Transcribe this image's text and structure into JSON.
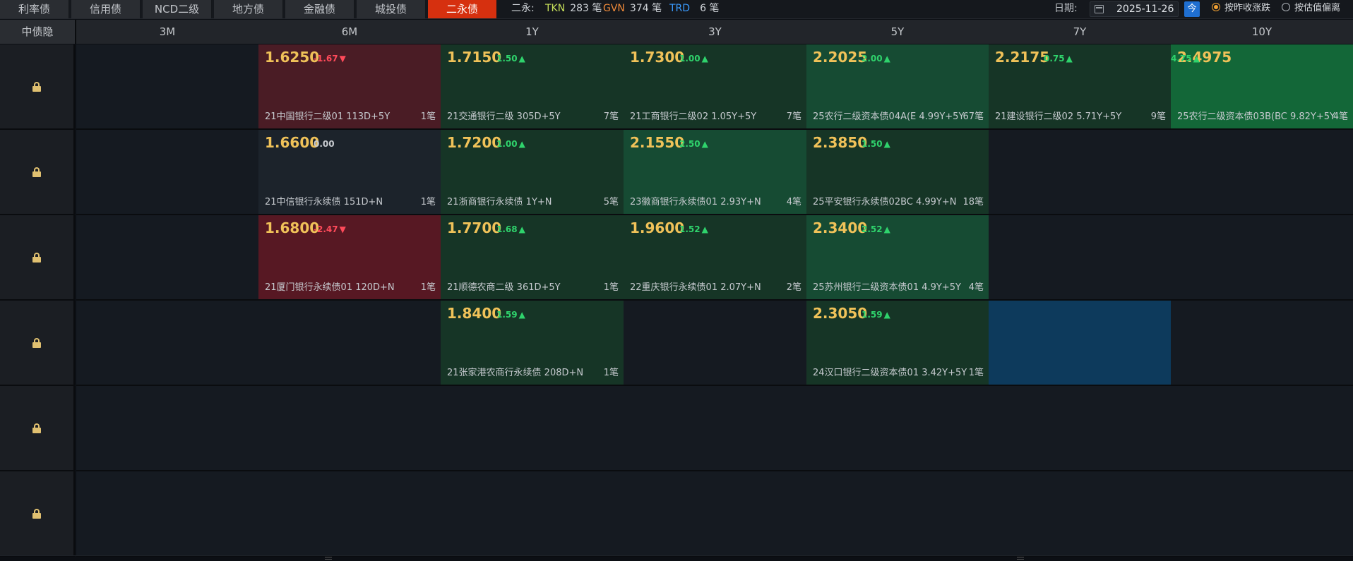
{
  "tabs": [
    {
      "label": "利率债",
      "active": false
    },
    {
      "label": "信用债",
      "active": false
    },
    {
      "label": "NCD二级",
      "active": false
    },
    {
      "label": "地方债",
      "active": false
    },
    {
      "label": "金融债",
      "active": false
    },
    {
      "label": "城投债",
      "active": false
    },
    {
      "label": "二永债",
      "active": true
    }
  ],
  "stats": {
    "prefix": "二永:",
    "tkn": {
      "key": "TKN",
      "value": "283 笔",
      "color": "#c7e05a"
    },
    "gvn": {
      "key": "GVN",
      "value": "374 笔",
      "color": "#f08a3a"
    },
    "trd": {
      "key": "TRD",
      "value": "6 笔",
      "color": "#3a9bff"
    }
  },
  "date": {
    "label": "日期:",
    "value": "2025-11-26",
    "today_button": "今"
  },
  "radios": [
    {
      "label": "按昨收涨跌",
      "checked": true
    },
    {
      "label": "按估值偏离",
      "checked": false
    }
  ],
  "columns": [
    "中债隐",
    "3M",
    "6M",
    "1Y",
    "3Y",
    "5Y",
    "7Y",
    "10Y"
  ],
  "rows": [
    {
      "cells": [
        null,
        {
          "yield": "1.6250",
          "change": "-1.67",
          "dir": "down",
          "bond": "21中国银行二级01 113D+5Y",
          "count": "1笔",
          "tone": "r-dark"
        },
        {
          "yield": "1.7150",
          "change": "1.50",
          "dir": "up",
          "bond": "21交通银行二级 305D+5Y",
          "count": "7笔",
          "tone": "g-dark"
        },
        {
          "yield": "1.7300",
          "change": "1.00",
          "dir": "up",
          "bond": "21工商银行二级02 1.05Y+5Y",
          "count": "7笔",
          "tone": "g-dark"
        },
        {
          "yield": "2.2025",
          "change": "2.00",
          "dir": "up",
          "bond": "25农行二级资本债04A(E 4.99Y+5Y",
          "count": "67笔",
          "tone": "g-mid"
        },
        {
          "yield": "2.2175",
          "change": "0.75",
          "dir": "up",
          "bond": "21建设银行二级02 5.71Y+5Y",
          "count": "9笔",
          "tone": "g-dark"
        },
        {
          "yield": "2.4975",
          "change": "4.75",
          "dir": "up",
          "bond": "25农行二级资本债03B(BC 9.82Y+5Y",
          "count": "4笔",
          "tone": "g-bright"
        }
      ]
    },
    {
      "cells": [
        null,
        {
          "yield": "1.6600",
          "change": "0.00",
          "dir": "flat",
          "bond": "21中信银行永续债 151D+N",
          "count": "1笔",
          "tone": "neutral"
        },
        {
          "yield": "1.7200",
          "change": "1.00",
          "dir": "up",
          "bond": "21浙商银行永续债 1Y+N",
          "count": "5笔",
          "tone": "g-dark"
        },
        {
          "yield": "2.1550",
          "change": "2.50",
          "dir": "up",
          "bond": "23徽商银行永续债01 2.93Y+N",
          "count": "4笔",
          "tone": "g-mid"
        },
        {
          "yield": "2.3850",
          "change": "1.50",
          "dir": "up",
          "bond": "25平安银行永续债02BC 4.99Y+N",
          "count": "18笔",
          "tone": "g-dark"
        },
        null,
        null
      ]
    },
    {
      "cells": [
        null,
        {
          "yield": "1.6800",
          "change": "-2.47",
          "dir": "down",
          "bond": "21厦门银行永续债01 120D+N",
          "count": "1笔",
          "tone": "r-mid"
        },
        {
          "yield": "1.7700",
          "change": "1.68",
          "dir": "up",
          "bond": "21顺德农商二级 361D+5Y",
          "count": "1笔",
          "tone": "g-dark"
        },
        {
          "yield": "1.9600",
          "change": "1.52",
          "dir": "up",
          "bond": "22重庆银行永续债01 2.07Y+N",
          "count": "2笔",
          "tone": "g-dark"
        },
        {
          "yield": "2.3400",
          "change": "2.52",
          "dir": "up",
          "bond": "25苏州银行二级资本债01 4.9Y+5Y",
          "count": "4笔",
          "tone": "g-mid"
        },
        null,
        null
      ]
    },
    {
      "cells": [
        null,
        null,
        {
          "yield": "1.8400",
          "change": "1.59",
          "dir": "up",
          "bond": "21张家港农商行永续债 208D+N",
          "count": "1笔",
          "tone": "g-dark"
        },
        null,
        {
          "yield": "2.3050",
          "change": "1.59",
          "dir": "up",
          "bond": "24汉口银行二级资本债01 3.42Y+5Y",
          "count": "1笔",
          "tone": "g-dark"
        },
        {
          "selected": true
        },
        null
      ]
    },
    {
      "cells": [
        null,
        null,
        null,
        null,
        null,
        null,
        null
      ]
    },
    {
      "cells": [
        null,
        null,
        null,
        null,
        null,
        null,
        null
      ]
    }
  ],
  "arrows": {
    "up": "▲",
    "down": "▼"
  }
}
